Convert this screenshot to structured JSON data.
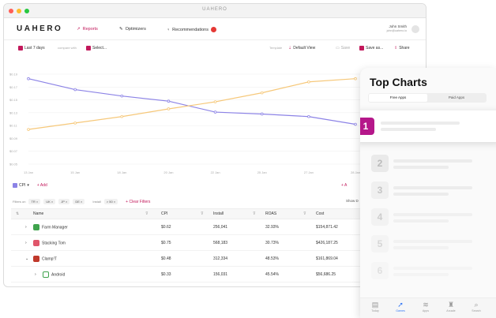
{
  "window": {
    "title": "UAHERO"
  },
  "nav": {
    "brand": "UAHERO",
    "items": [
      {
        "label": "Reports",
        "active": true
      },
      {
        "label": "Optimizers",
        "active": false
      },
      {
        "label": "Recommendations",
        "active": false
      }
    ],
    "user_name": "John Smith",
    "user_email": "john@uahero.io"
  },
  "toolbar": {
    "date_range": "Last 7 days",
    "compare_label": "compare with",
    "select_label": "Select...",
    "template_label": "Template",
    "view_label": "Default View",
    "save_label": "Save",
    "save_as_label": "Save as...",
    "share_label": "Share"
  },
  "chart_data": {
    "type": "line",
    "x": [
      "13 Jan",
      "15 Jan",
      "18 Jan",
      "20 Jan",
      "22 Jan",
      "25 Jan",
      "27 Jan",
      "28 Jan"
    ],
    "y_ticks": [
      "$0.19",
      "$0.17",
      "$0.15",
      "$0.13",
      "$0.11",
      "$0.09",
      "$0.07",
      "$0.05"
    ],
    "ylim": [
      0.05,
      0.19
    ],
    "series": [
      {
        "name": "CPI",
        "color": "#8c83e6",
        "values": [
          0.183,
          0.166,
          0.156,
          0.148,
          0.131,
          0.128,
          0.124,
          0.112
        ]
      },
      {
        "name": "",
        "color": "#f6c87a",
        "values": [
          0.104,
          0.114,
          0.124,
          0.136,
          0.147,
          0.161,
          0.178,
          0.183
        ]
      }
    ],
    "grid": true
  },
  "metrics": {
    "metric_label": "CPI",
    "add_label": "Add",
    "add_right_label": "A"
  },
  "filters": {
    "prefix": "Filters on",
    "chips": [
      "TR",
      "UK",
      "JP",
      "DE"
    ],
    "install_prefix": "Install",
    "install_chip": "> 50",
    "clear_label": "Clear Filters",
    "show_label": "Show D"
  },
  "table": {
    "columns": [
      "Name",
      "CPI",
      "Install",
      "ROAS",
      "Cost"
    ],
    "rows": [
      {
        "name": "Farm Manager",
        "cpi": "$0.62",
        "install": "256,041",
        "roas": "32.93%",
        "cost": "$154,871.42",
        "color": "#3fa34d"
      },
      {
        "name": "Stacking Tom",
        "cpi": "$0.75",
        "install": "568,183",
        "roas": "30.73%",
        "cost": "$426,187.25",
        "color": "#e0566b"
      },
      {
        "name": "Clamp!T",
        "cpi": "$0.48",
        "install": "312,334",
        "roas": "48.53%",
        "cost": "$161,869.04",
        "color": "#c0392b"
      },
      {
        "name": "Android",
        "cpi": "$0.33",
        "install": "156,031",
        "roas": "45.54%",
        "cost": "$56,686.25",
        "color": "#ffffff"
      }
    ]
  },
  "phone": {
    "title": "Top Charts",
    "segments": [
      "Free Apps",
      "Paid Apps"
    ],
    "ranks": [
      "1",
      "2",
      "3",
      "4",
      "5",
      "6"
    ],
    "tabs": [
      {
        "label": "Today",
        "icon": "today-icon"
      },
      {
        "label": "Games",
        "icon": "rocket-icon"
      },
      {
        "label": "Apps",
        "icon": "stack-icon"
      },
      {
        "label": "Arcade",
        "icon": "joystick-icon"
      },
      {
        "label": "Search",
        "icon": "search-icon"
      }
    ]
  }
}
